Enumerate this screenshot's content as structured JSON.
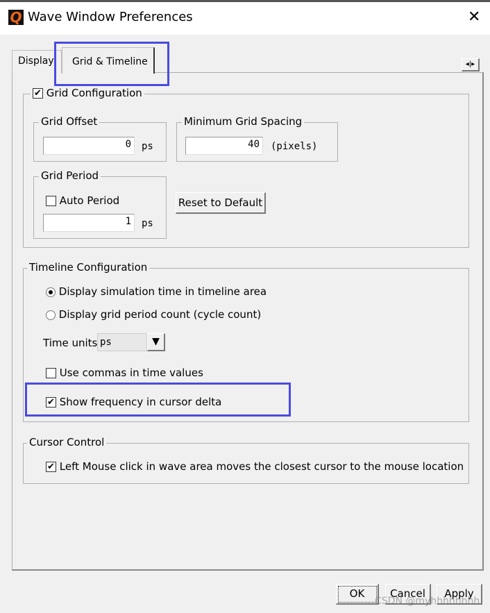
{
  "window": {
    "title": "Wave Window Preferences",
    "logo": "Q"
  },
  "tabs": [
    {
      "label": "Display"
    },
    {
      "label": "Grid & Timeline",
      "active": true
    }
  ],
  "grid_config": {
    "label": "Grid Configuration",
    "checked": true,
    "offset": {
      "label": "Grid Offset",
      "value": "0",
      "unit": "ps"
    },
    "min_spacing": {
      "label": "Minimum Grid Spacing",
      "value": "40",
      "unit": "(pixels)"
    },
    "period": {
      "label": "Grid Period",
      "auto_label": "Auto Period",
      "auto_checked": false,
      "value": "1",
      "unit": "ps"
    },
    "reset_label": "Reset to Default"
  },
  "timeline": {
    "label": "Timeline Configuration",
    "radio1": "Display simulation time in timeline area",
    "radio2": "Display grid period count (cycle count)",
    "selected": 1,
    "time_units_label": "Time units",
    "time_units_value": "ps",
    "commas_label": "Use commas in time values",
    "commas_checked": false,
    "freq_label": "Show frequency in cursor delta",
    "freq_checked": true
  },
  "cursor": {
    "label": "Cursor Control",
    "option_label": "Left Mouse click in wave area moves the closest cursor to the mouse location",
    "checked": true
  },
  "buttons": {
    "ok": "OK",
    "cancel": "Cancel",
    "apply": "Apply"
  },
  "watermark": "CSDN @myhhhhhhhh",
  "highlight_color": "#4a4ae0"
}
